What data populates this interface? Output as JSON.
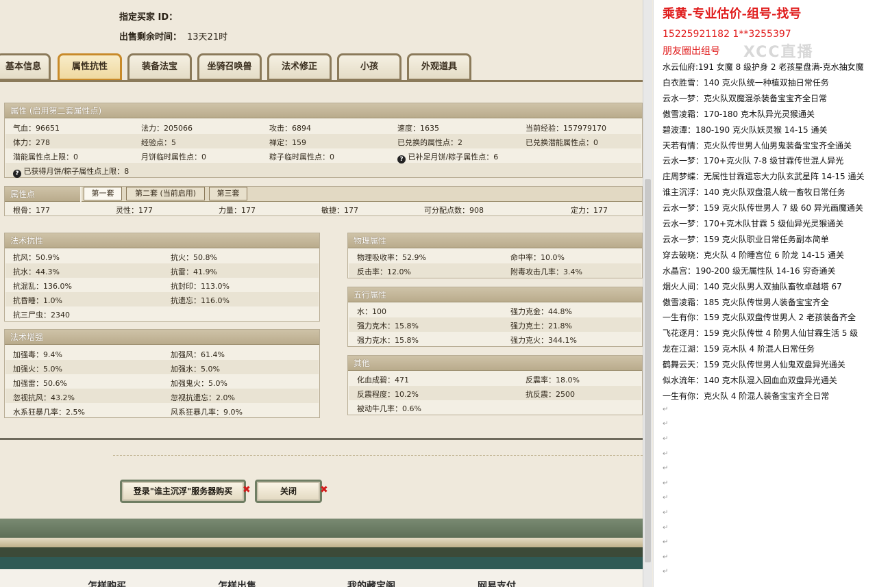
{
  "header": {
    "buyer_label": "指定买家 ID：",
    "time_label": "出售剩余时间：",
    "time_value": "13天21时"
  },
  "tabs": [
    "基本信息",
    "属性抗性",
    "装备法宝",
    "坐骑召唤兽",
    "法术修正",
    "小孩",
    "外观道具"
  ],
  "active_tab": "属性抗性",
  "attr_panel": {
    "title": "属性 (启用第二套属性点)",
    "rows": [
      [
        "气血：96651",
        "法力：205066",
        "攻击：6894",
        "速度：1635",
        "当前经验：157979170"
      ],
      [
        "体力：278",
        "经验点：5",
        "禅定：159",
        "已兑换的属性点：2",
        "已兑换潜能属性点：0"
      ],
      [
        "潜能属性点上限：0",
        "月饼临时属性点：0",
        "粽子临时属性点：0",
        "已补足月饼/粽子属性点：6",
        ""
      ]
    ],
    "last_row": "已获得月饼/粽子属性点上限：8"
  },
  "points_panel": {
    "title": "属性点",
    "subtabs": [
      "第一套",
      "第二套 (当前启用)",
      "第三套"
    ],
    "values": [
      "根骨：177",
      "灵性：177",
      "力量：177",
      "敏捷：177",
      "可分配点数：908",
      "定力：177"
    ]
  },
  "resist_panel": {
    "title": "法术抗性",
    "rows": [
      [
        "抗风：50.9%",
        "抗火：50.8%"
      ],
      [
        "抗水：44.3%",
        "抗雷：41.9%"
      ],
      [
        "抗混乱：136.0%",
        "抗封印：113.0%"
      ],
      [
        "抗昏睡：1.0%",
        "抗遗忘：116.0%"
      ],
      [
        "抗三尸虫：2340",
        ""
      ]
    ]
  },
  "enhance_panel": {
    "title": "法术增强",
    "rows": [
      [
        "加强毒：9.4%",
        "加强风：61.4%"
      ],
      [
        "加强火：5.0%",
        "加强水：5.0%"
      ],
      [
        "加强雷：50.6%",
        "加强鬼火：5.0%"
      ],
      [
        "忽视抗风：43.2%",
        "忽视抗遗忘：2.0%"
      ],
      [
        "水系狂暴几率：2.5%",
        "风系狂暴几率：9.0%"
      ]
    ]
  },
  "physical_panel": {
    "title": "物理属性",
    "rows": [
      [
        "物理吸收率：52.9%",
        "命中率：10.0%"
      ],
      [
        "反击率：12.0%",
        "附毒攻击几率：3.4%"
      ]
    ]
  },
  "five_panel": {
    "title": "五行属性",
    "rows": [
      [
        "水：100",
        "强力克金：44.8%"
      ],
      [
        "强力克木：15.8%",
        "强力克土：21.8%"
      ],
      [
        "强力克水：15.8%",
        "强力克火：344.1%"
      ]
    ]
  },
  "other_panel": {
    "title": "其他",
    "rows": [
      [
        "化血成碧：471",
        "反震率：18.0%"
      ],
      [
        "反震程度：10.2%",
        "抗反震：2500"
      ],
      [
        "被动牛几率：0.6%",
        ""
      ]
    ]
  },
  "buttons": {
    "login": "登录\"谁主沉浮\"服务器购买",
    "close": "关闭"
  },
  "footer_links": [
    "怎样购买",
    "怎样出售",
    "我的藏宝阁",
    "网易支付"
  ],
  "doc": {
    "title": "乘黄-专业估价-组号-找号",
    "phone": "15225921182    1**3255397",
    "wechat": "朋友圈出组号",
    "watermark": "XCC直播",
    "lines": [
      "水云仙府:191 女魔 8 级护身 2 老孩星盘满-克水抽女魔",
      "白衣胜雪：140 克火队统一种植双抽日常任务",
      "云水一梦：克火队双魔混杀装备宝宝齐全日常",
      "傲雪凌霜：170-180 克木队异光灵猴通关",
      "碧波潭：180-190 克火队妖灵猴 14-15 通关",
      "天若有情：克火队传世男人仙男鬼装备宝宝齐全通关",
      "云水一梦：170+克火队 7-8 级甘霖传世混人异光",
      "庄周梦蝶：无属性甘霖遗忘大力队玄武星阵 14-15 通关",
      "谁主沉浮：140 克火队双盘混人统一畜牧日常任务",
      "云水一梦：159 克火队传世男人 7 级 60 异光画魔通关",
      "云水一梦：170+克木队甘霖 5 级仙异光灵猴通关",
      "云水一梦：159 克火队职业日常任务副本简单",
      "穿去破晓：克火队 4 阶睡宫位 6 阶龙 14-15 通关",
      "水晶宫：190-200 级无属性队 14-16 穷奇通关",
      "烟火人间：140 克火队男人双抽队畜牧卓越塔 67",
      "傲雪凌霜：185 克火队传世男人装备宝宝齐全",
      "一生有你：159 克火队双盘传世男人 2 老孩装备齐全",
      "飞花逐月：159 克火队传世 4 阶男人仙甘霖生活 5 级",
      "龙在江湖：159 克木队 4 阶混人日常任务",
      "鹤舞云天：159 克火队传世男人仙鬼双盘异光通关",
      "似水流年：140 克木队混入回血血双盘异光通关",
      "一生有你：克火队 4 阶混人装备宝宝齐全日常"
    ],
    "pilcrow": "↵"
  },
  "colors": {
    "panel_title": "#b9ab8c",
    "tab_active_border": "#c88a2a",
    "doc_red": "#e01c1c"
  }
}
